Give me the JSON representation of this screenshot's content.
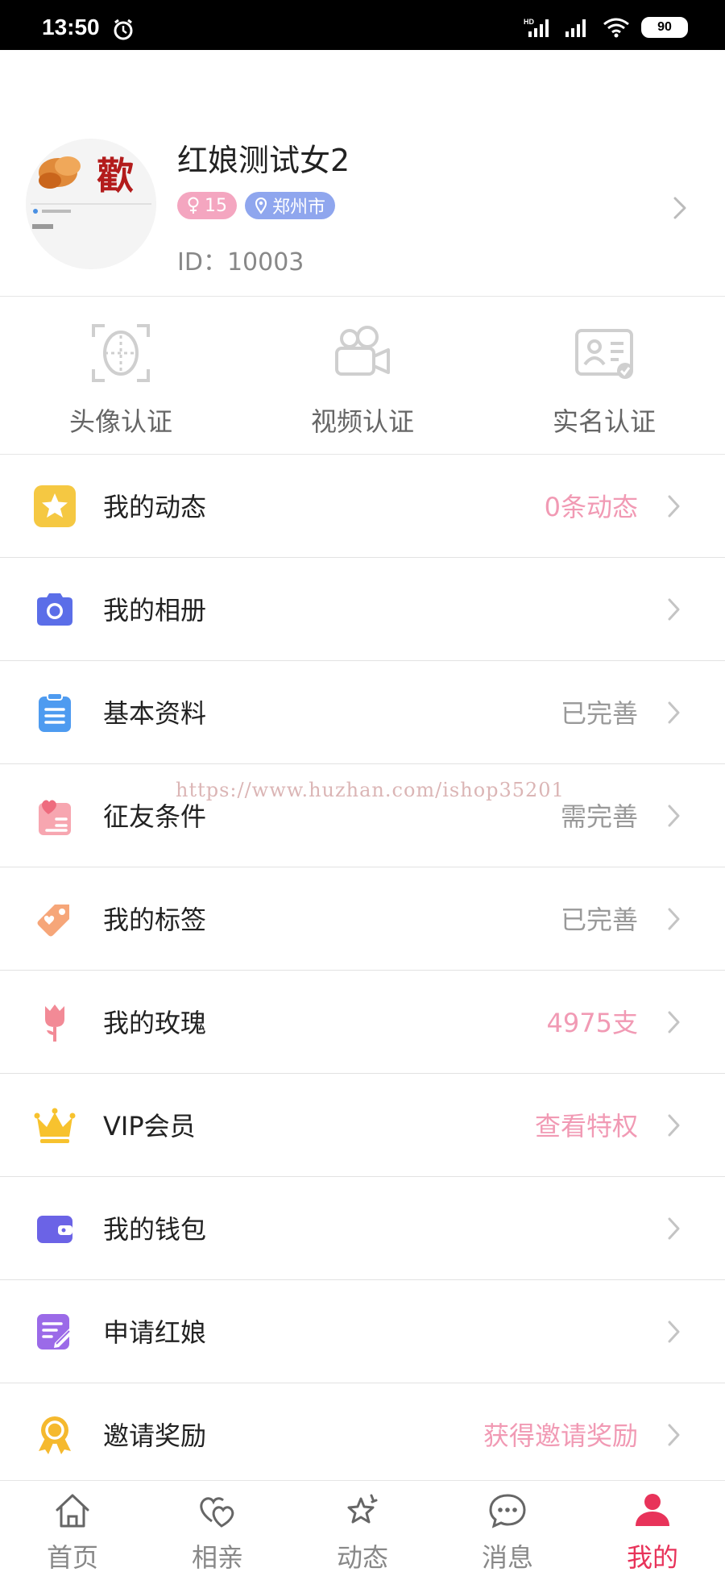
{
  "status_bar": {
    "time": "13:50",
    "battery": "90"
  },
  "profile": {
    "name": "红娘测试女2",
    "age": "15",
    "city": "郑州市",
    "id_text": "ID：10003",
    "avatar_glyph": "歡"
  },
  "verify": [
    {
      "label": "头像认证",
      "icon": "face-scan-icon"
    },
    {
      "label": "视频认证",
      "icon": "video-camera-icon"
    },
    {
      "label": "实名认证",
      "icon": "id-card-icon"
    }
  ],
  "menu": [
    {
      "label": "我的动态",
      "value": "0条动态",
      "value_color": "pink",
      "icon": "star-icon",
      "color": "#f5c842"
    },
    {
      "label": "我的相册",
      "value": "",
      "value_color": "gray",
      "icon": "camera-icon",
      "color": "#5b6ee8"
    },
    {
      "label": "基本资料",
      "value": "已完善",
      "value_color": "gray",
      "icon": "clipboard-icon",
      "color": "#4e9bf0"
    },
    {
      "label": "征友条件",
      "value": "需完善",
      "value_color": "gray",
      "icon": "heart-list-icon",
      "color": "#f28a96"
    },
    {
      "label": "我的标签",
      "value": "已完善",
      "value_color": "gray",
      "icon": "tag-icon",
      "color": "#f6a679"
    },
    {
      "label": "我的玫瑰",
      "value": "4975支",
      "value_color": "pink",
      "icon": "rose-icon",
      "color": "#f28a96"
    },
    {
      "label": "VIP会员",
      "value": "查看特权",
      "value_color": "pink",
      "icon": "crown-icon",
      "color": "#f7c22e"
    },
    {
      "label": "我的钱包",
      "value": "",
      "value_color": "gray",
      "icon": "wallet-icon",
      "color": "#6b63e6"
    },
    {
      "label": "申请红娘",
      "value": "",
      "value_color": "gray",
      "icon": "edit-form-icon",
      "color": "#9b6ae8"
    },
    {
      "label": "邀请奖励",
      "value": "获得邀请奖励",
      "value_color": "pink",
      "icon": "medal-icon",
      "color": "#f5b92e"
    }
  ],
  "nav": [
    {
      "label": "首页",
      "icon": "home-icon"
    },
    {
      "label": "相亲",
      "icon": "hearts-icon"
    },
    {
      "label": "动态",
      "icon": "star-stack-icon"
    },
    {
      "label": "消息",
      "icon": "chat-bubble-icon"
    },
    {
      "label": "我的",
      "icon": "user-icon"
    }
  ],
  "active_nav": "我的",
  "watermark": "https://www.huzhan.com/ishop35201"
}
